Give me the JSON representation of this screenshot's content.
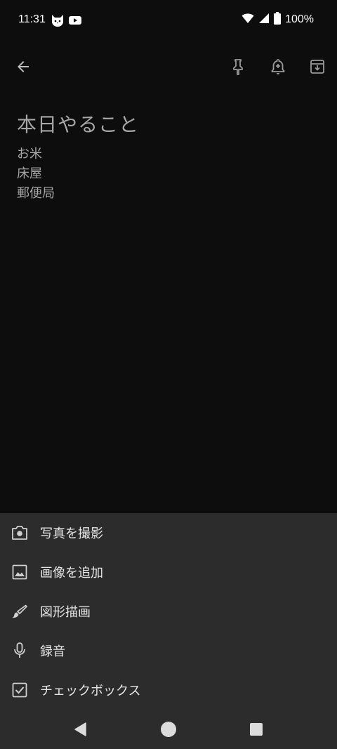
{
  "status_bar": {
    "time": "11:31",
    "battery": "100%",
    "icons": [
      "cat-app-icon",
      "youtube-icon",
      "wifi-icon",
      "cell-signal-icon",
      "battery-icon"
    ]
  },
  "toolbar": {
    "icons": [
      "back-arrow-icon",
      "pin-icon",
      "reminder-bell-icon",
      "archive-icon"
    ]
  },
  "note": {
    "title": "本日やること",
    "lines": [
      "お米",
      "床屋",
      "郵便局"
    ]
  },
  "sheet": {
    "items": [
      {
        "label": "写真を撮影",
        "icon": "camera-icon"
      },
      {
        "label": "画像を追加",
        "icon": "image-icon"
      },
      {
        "label": "図形描画",
        "icon": "brush-icon"
      },
      {
        "label": "録音",
        "icon": "microphone-icon"
      },
      {
        "label": "チェックボックス",
        "icon": "checkbox-icon"
      }
    ]
  },
  "nav": {
    "icons": [
      "back-triangle-icon",
      "home-circle-icon",
      "recents-square-icon"
    ]
  },
  "colors": {
    "background": "#0d0d0d",
    "sheet": "#2c2c2c",
    "muted_text": "#a6a6a6",
    "icon_gray": "#9a9a9a"
  }
}
